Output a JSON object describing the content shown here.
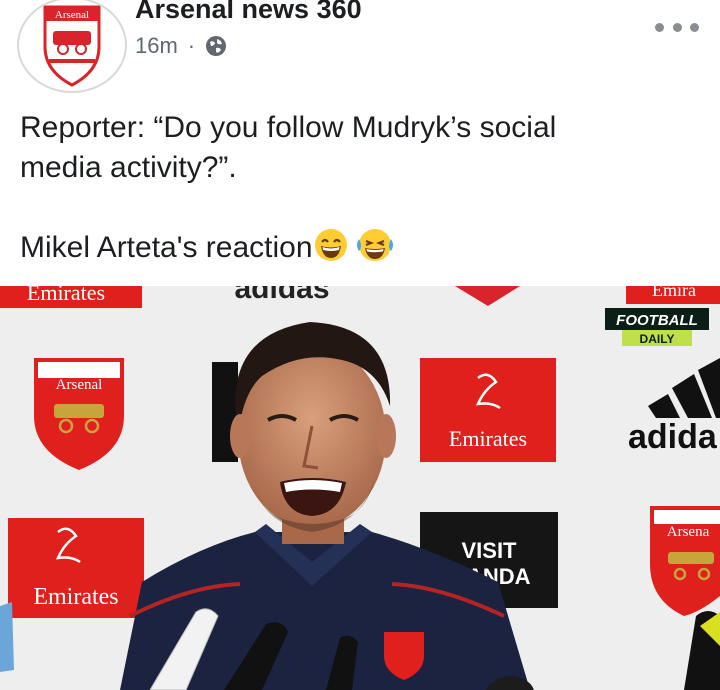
{
  "post": {
    "page_name": "Arsenal news 360",
    "timestamp": "16m",
    "separator": "·",
    "audience_icon": "globe-icon",
    "more_icon": "more-options-icon",
    "avatar_text": "Arsenal",
    "text_line_1": "Reporter: “Do you follow Mudryk’s social",
    "text_line_2": "media activity?”.",
    "text_line_3": "Mikel Arteta's reaction",
    "reaction_emojis": [
      "grinning-face-with-smiling-eyes",
      "face-with-tears-of-joy"
    ]
  },
  "photo": {
    "sponsor_top_left": "Emirates",
    "sponsor_top_center": "adidas",
    "sponsor_top_right": "Emira",
    "badge_line_1": "FOOTBALL",
    "badge_line_2": "DAILY",
    "crest_left": "Arsenal",
    "crest_right": "Arsena",
    "emirates_center": "Emirates",
    "emirates_left": "Emirates",
    "adidas_right": "adida",
    "visit_line_1": "VISIT",
    "visit_line_2": "WANDA"
  },
  "colors": {
    "arsenal_red": "#e0201d",
    "text_primary": "#1c1e21",
    "text_secondary": "#606770"
  }
}
